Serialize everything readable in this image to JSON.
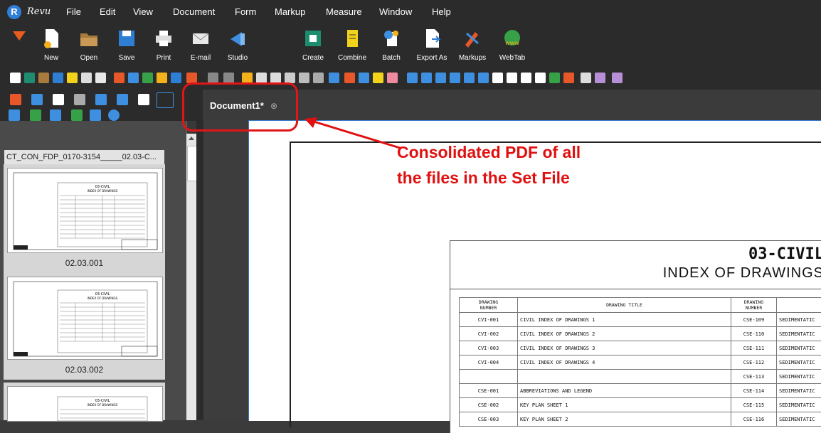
{
  "app": {
    "brand": "Revu"
  },
  "menu": [
    "File",
    "Edit",
    "View",
    "Document",
    "Form",
    "Markup",
    "Measure",
    "Window",
    "Help"
  ],
  "ribbon": {
    "buttons": [
      {
        "label": "New",
        "icon": "new-document-icon"
      },
      {
        "label": "Open",
        "icon": "open-folder-icon"
      },
      {
        "label": "Save",
        "icon": "save-icon"
      },
      {
        "label": "Print",
        "icon": "print-icon"
      },
      {
        "label": "E-mail",
        "icon": "email-icon"
      },
      {
        "label": "Studio",
        "icon": "studio-icon"
      },
      {
        "label": "Create",
        "icon": "create-pdf-icon"
      },
      {
        "label": "Combine",
        "icon": "combine-icon"
      },
      {
        "label": "Batch",
        "icon": "batch-icon"
      },
      {
        "label": "Export As",
        "icon": "export-icon"
      },
      {
        "label": "Markups",
        "icon": "markups-icon"
      },
      {
        "label": "WebTab",
        "icon": "webtab-icon"
      }
    ]
  },
  "document_tab": {
    "label": "Document1*",
    "close_glyph": "⊗"
  },
  "thumbnails": {
    "header": "CT_CON_FDP_0170-3154_____02.03-C...",
    "pages": [
      {
        "label": "02.03.001"
      },
      {
        "label": "02.03.002"
      }
    ]
  },
  "document": {
    "title": "03-CIVIL",
    "subtitle": "INDEX OF DRAWINGS",
    "table": {
      "headers": [
        "DRAWING\nNUMBER",
        "DRAWING TITLE",
        "DRAWING\nNUMBER",
        ""
      ],
      "rows": [
        [
          "CVI-001",
          "CIVIL INDEX OF DRAWINGS 1",
          "CSE-109",
          "SEDIMENTATIC"
        ],
        [
          "CVI-002",
          "CIVIL INDEX OF DRAWINGS 2",
          "CSE-110",
          "SEDIMENTATIC"
        ],
        [
          "CVI-003",
          "CIVIL INDEX OF DRAWINGS 3",
          "CSE-111",
          "SEDIMENTATIC"
        ],
        [
          "CVI-004",
          "CIVIL INDEX OF DRAWINGS 4",
          "CSE-112",
          "SEDIMENTATIC"
        ],
        [
          "",
          "",
          "CSE-113",
          "SEDIMENTATIC"
        ],
        [
          "CSE-001",
          "ABBREVIATIONS AND LEGEND",
          "CSE-114",
          "SEDIMENTATIC"
        ],
        [
          "CSE-002",
          "KEY PLAN SHEET 1",
          "CSE-115",
          "SEDIMENTATIC"
        ],
        [
          "CSE-003",
          "KEY PLAN SHEET 2",
          "CSE-116",
          "SEDIMENTATIC"
        ]
      ]
    }
  },
  "annotation": {
    "line1": "Consolidated PDF of all",
    "line2": "the files in the Set File",
    "color": "#e01010"
  }
}
